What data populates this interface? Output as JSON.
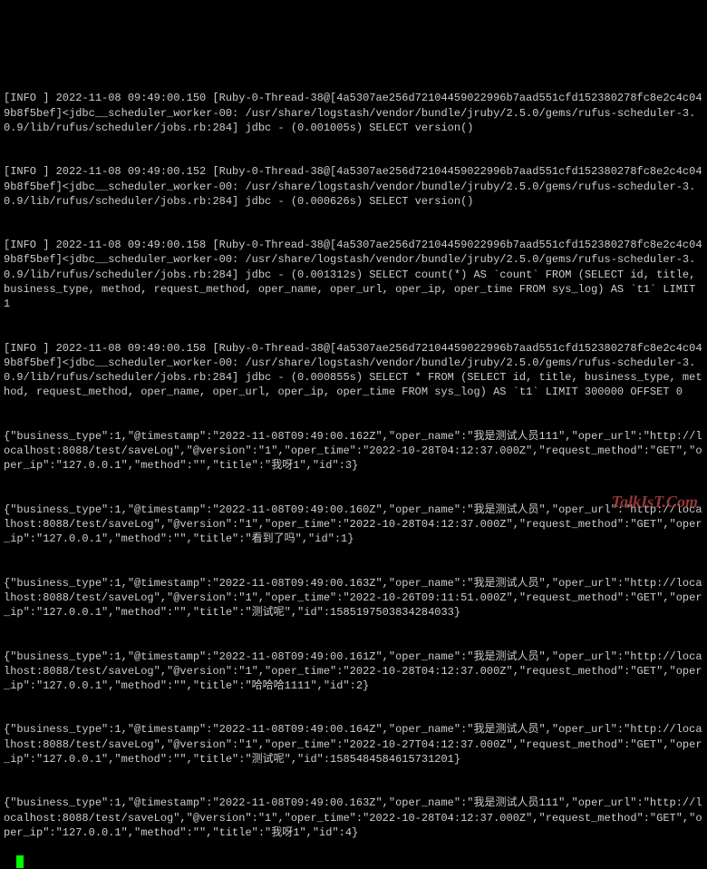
{
  "watermark": "TalkIsT.Com",
  "lines": [
    "[INFO ] 2022-11-08 09:49:00.150 [Ruby-0-Thread-38@[4a5307ae256d72104459022996b7aad551cfd152380278fc8e2c4c049b8f5bef]<jdbc__scheduler_worker-00: /usr/share/logstash/vendor/bundle/jruby/2.5.0/gems/rufus-scheduler-3.0.9/lib/rufus/scheduler/jobs.rb:284] jdbc - (0.001005s) SELECT version()",
    "[INFO ] 2022-11-08 09:49:00.152 [Ruby-0-Thread-38@[4a5307ae256d72104459022996b7aad551cfd152380278fc8e2c4c049b8f5bef]<jdbc__scheduler_worker-00: /usr/share/logstash/vendor/bundle/jruby/2.5.0/gems/rufus-scheduler-3.0.9/lib/rufus/scheduler/jobs.rb:284] jdbc - (0.000626s) SELECT version()",
    "[INFO ] 2022-11-08 09:49:00.158 [Ruby-0-Thread-38@[4a5307ae256d72104459022996b7aad551cfd152380278fc8e2c4c049b8f5bef]<jdbc__scheduler_worker-00: /usr/share/logstash/vendor/bundle/jruby/2.5.0/gems/rufus-scheduler-3.0.9/lib/rufus/scheduler/jobs.rb:284] jdbc - (0.001312s) SELECT count(*) AS `count` FROM (SELECT id, title, business_type, method, request_method, oper_name, oper_url, oper_ip, oper_time FROM sys_log) AS `t1` LIMIT 1",
    "[INFO ] 2022-11-08 09:49:00.158 [Ruby-0-Thread-38@[4a5307ae256d72104459022996b7aad551cfd152380278fc8e2c4c049b8f5bef]<jdbc__scheduler_worker-00: /usr/share/logstash/vendor/bundle/jruby/2.5.0/gems/rufus-scheduler-3.0.9/lib/rufus/scheduler/jobs.rb:284] jdbc - (0.000855s) SELECT * FROM (SELECT id, title, business_type, method, request_method, oper_name, oper_url, oper_ip, oper_time FROM sys_log) AS `t1` LIMIT 300000 OFFSET 0",
    "{\"business_type\":1,\"@timestamp\":\"2022-11-08T09:49:00.162Z\",\"oper_name\":\"我是测试人员111\",\"oper_url\":\"http://localhost:8088/test/saveLog\",\"@version\":\"1\",\"oper_time\":\"2022-10-28T04:12:37.000Z\",\"request_method\":\"GET\",\"oper_ip\":\"127.0.0.1\",\"method\":\"\",\"title\":\"我呀1\",\"id\":3}",
    "{\"business_type\":1,\"@timestamp\":\"2022-11-08T09:49:00.160Z\",\"oper_name\":\"我是测试人员\",\"oper_url\":\"http://localhost:8088/test/saveLog\",\"@version\":\"1\",\"oper_time\":\"2022-10-28T04:12:37.000Z\",\"request_method\":\"GET\",\"oper_ip\":\"127.0.0.1\",\"method\":\"\",\"title\":\"看到了吗\",\"id\":1}",
    "{\"business_type\":1,\"@timestamp\":\"2022-11-08T09:49:00.163Z\",\"oper_name\":\"我是测试人员\",\"oper_url\":\"http://localhost:8088/test/saveLog\",\"@version\":\"1\",\"oper_time\":\"2022-10-26T09:11:51.000Z\",\"request_method\":\"GET\",\"oper_ip\":\"127.0.0.1\",\"method\":\"\",\"title\":\"测试呢\",\"id\":1585197503834284033}",
    "{\"business_type\":1,\"@timestamp\":\"2022-11-08T09:49:00.161Z\",\"oper_name\":\"我是测试人员\",\"oper_url\":\"http://localhost:8088/test/saveLog\",\"@version\":\"1\",\"oper_time\":\"2022-10-28T04:12:37.000Z\",\"request_method\":\"GET\",\"oper_ip\":\"127.0.0.1\",\"method\":\"\",\"title\":\"哈哈哈1111\",\"id\":2}",
    "{\"business_type\":1,\"@timestamp\":\"2022-11-08T09:49:00.164Z\",\"oper_name\":\"我是测试人员\",\"oper_url\":\"http://localhost:8088/test/saveLog\",\"@version\":\"1\",\"oper_time\":\"2022-10-27T04:12:37.000Z\",\"request_method\":\"GET\",\"oper_ip\":\"127.0.0.1\",\"method\":\"\",\"title\":\"测试呢\",\"id\":1585484584615731201}",
    "{\"business_type\":1,\"@timestamp\":\"2022-11-08T09:49:00.163Z\",\"oper_name\":\"我是测试人员111\",\"oper_url\":\"http://localhost:8088/test/saveLog\",\"@version\":\"1\",\"oper_time\":\"2022-10-28T04:12:37.000Z\",\"request_method\":\"GET\",\"oper_ip\":\"127.0.0.1\",\"method\":\"\",\"title\":\"我呀1\",\"id\":4}"
  ]
}
